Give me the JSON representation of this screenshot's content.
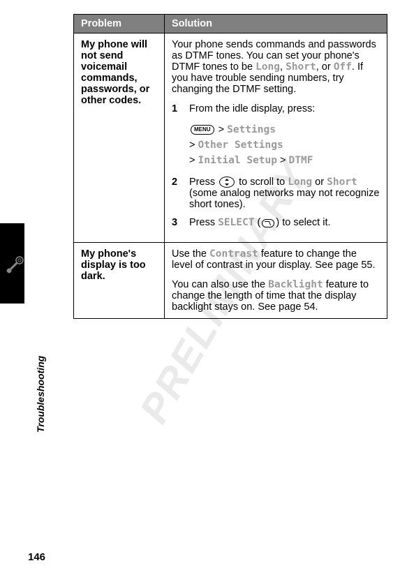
{
  "watermark": "PRELIMINARY",
  "side_label": "Troubleshooting",
  "page_number": "146",
  "table": {
    "headers": {
      "problem": "Problem",
      "solution": "Solution"
    },
    "rows": [
      {
        "problem": "My phone will not send voicemail commands, passwords, or other codes.",
        "intro_parts": {
          "p1": "Your phone sends commands and passwords as DTMF tones. You can set your phone's DTMF tones to be ",
          "long": "Long",
          "comma1": ", ",
          "short": "Short",
          "or": ", or ",
          "off": "Off",
          "p2": ". If you have trouble sending numbers, try changing the DTMF setting."
        },
        "steps": {
          "s1": {
            "num": "1",
            "text": "From the idle display, press:"
          },
          "nav": {
            "gt1": " > ",
            "settings": "Settings",
            "gt2": "> ",
            "other": "Other Settings",
            "gt3": "> ",
            "initial": "Initial Setup",
            "gt4": " > ",
            "dtmf": "DTMF"
          },
          "s2": {
            "num": "2",
            "p1": "Press ",
            "p2": " to scroll to ",
            "long": "Long",
            "or": " or ",
            "short": "Short",
            "p3": " (some analog networks may not recognize short tones)."
          },
          "s3": {
            "num": "3",
            "p1": "Press ",
            "select": "SELECT",
            "p2": " (",
            "p3": ") to select it."
          }
        }
      },
      {
        "problem": "My phone's display is too dark.",
        "para1": {
          "p1": "Use the ",
          "contrast": "Contrast",
          "p2": " feature to change the level of contrast in your display. See page 55."
        },
        "para2": {
          "p1": "You can also use the ",
          "backlight": "Backlight",
          "p2": " feature to change the length of time that the display backlight stays on. See page 54."
        }
      }
    ]
  },
  "icons": {
    "menu_label": "MENU"
  }
}
